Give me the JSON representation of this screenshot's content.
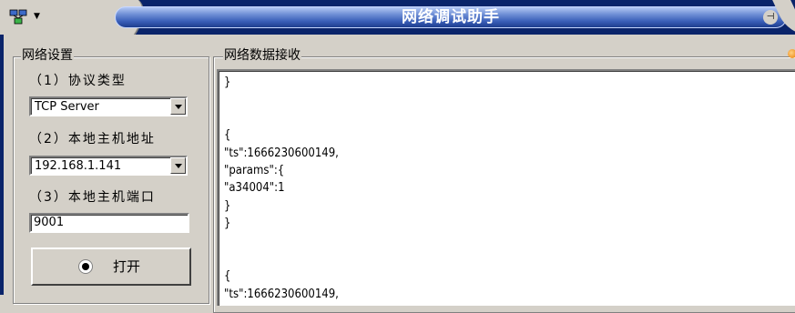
{
  "window": {
    "title": "网络调试助手"
  },
  "network_settings": {
    "legend": "网络设置",
    "protocol": {
      "label": "（1）协议类型",
      "value": "TCP Server"
    },
    "local_ip": {
      "label": "（2）本地主机地址",
      "value": "192.168.1.141"
    },
    "local_port": {
      "label": "（3）本地主机端口",
      "value": "9001"
    },
    "open_button": {
      "label": "打开"
    }
  },
  "receive": {
    "legend": "网络数据接收",
    "lines": [
      "}",
      "",
      "",
      "{",
      "\"ts\":1666230600149,",
      "\"params\":{",
      "\"a34004\":1",
      "}",
      "}",
      "",
      "",
      "{",
      "\"ts\":1666230600149,"
    ]
  },
  "colors": {
    "titlebar_dark": "#0a246a",
    "titlebar_bar": "#3a5fb8",
    "window_face": "#d4d0c8",
    "field_bg": "#ffffff"
  }
}
